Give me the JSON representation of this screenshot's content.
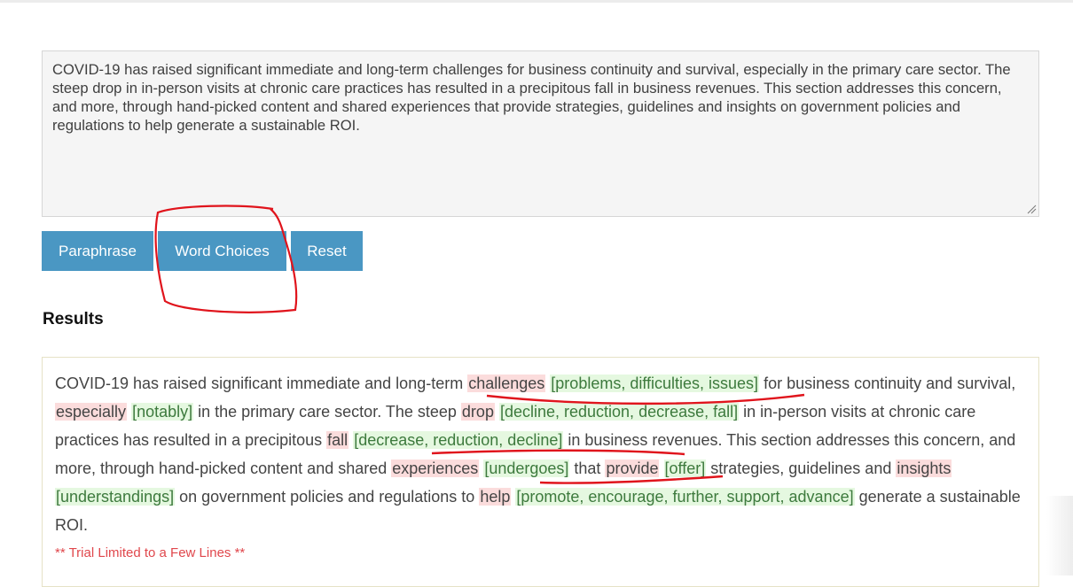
{
  "input": {
    "text": "COVID-19 has raised significant immediate and long-term challenges for business continuity and survival, especially in the primary care sector. The steep drop in in-person visits at chronic care practices has resulted in a precipitous fall in business revenues. This section addresses this concern, and more, through hand-picked content and shared experiences that provide strategies, guidelines and insights on government policies and regulations to help generate a sustainable ROI."
  },
  "buttons": {
    "paraphrase": "Paraphrase",
    "word_choices": "Word Choices",
    "reset": "Reset"
  },
  "results": {
    "title": "Results",
    "segments": [
      {
        "t": "COVID-19 has raised significant immediate and long-term "
      },
      {
        "t": "challenges",
        "k": "orig"
      },
      {
        "t": " "
      },
      {
        "t": "[problems, difficulties, issues]",
        "k": "sugg"
      },
      {
        "t": " for business continuity and survival, "
      },
      {
        "t": "especially",
        "k": "orig"
      },
      {
        "t": " "
      },
      {
        "t": "[notably]",
        "k": "sugg"
      },
      {
        "t": " in the primary care sector. The steep "
      },
      {
        "t": "drop",
        "k": "orig"
      },
      {
        "t": " "
      },
      {
        "t": "[decline, reduction, decrease, fall]",
        "k": "sugg"
      },
      {
        "t": " in in-person visits at chronic care practices has resulted in a precipitous "
      },
      {
        "t": "fall",
        "k": "orig"
      },
      {
        "t": " "
      },
      {
        "t": "[decrease, reduction, decline]",
        "k": "sugg"
      },
      {
        "t": " in business revenues. This section addresses this concern, and more, through hand-picked content and shared "
      },
      {
        "t": "experiences",
        "k": "orig"
      },
      {
        "t": " "
      },
      {
        "t": "[undergoes]",
        "k": "sugg"
      },
      {
        "t": " that "
      },
      {
        "t": "provide",
        "k": "orig"
      },
      {
        "t": " "
      },
      {
        "t": "[offer]",
        "k": "sugg"
      },
      {
        "t": " strategies, guidelines and "
      },
      {
        "t": "insights",
        "k": "orig"
      },
      {
        "t": " "
      },
      {
        "t": "[understandings]",
        "k": "sugg"
      },
      {
        "t": " on government policies and regulations to "
      },
      {
        "t": "help",
        "k": "orig"
      },
      {
        "t": " "
      },
      {
        "t": "[promote, encourage, further, support, advance]",
        "k": "sugg"
      },
      {
        "t": " generate a sustainable ROI."
      }
    ],
    "trial_notice": "** Trial Limited to a Few Lines **"
  },
  "colors": {
    "button_bg": "#4a97c3",
    "highlight_original": "#fbdcdc",
    "highlight_suggestion": "#e5f8e0",
    "annotation": "#e0141c",
    "trial_text": "#e0474c"
  }
}
